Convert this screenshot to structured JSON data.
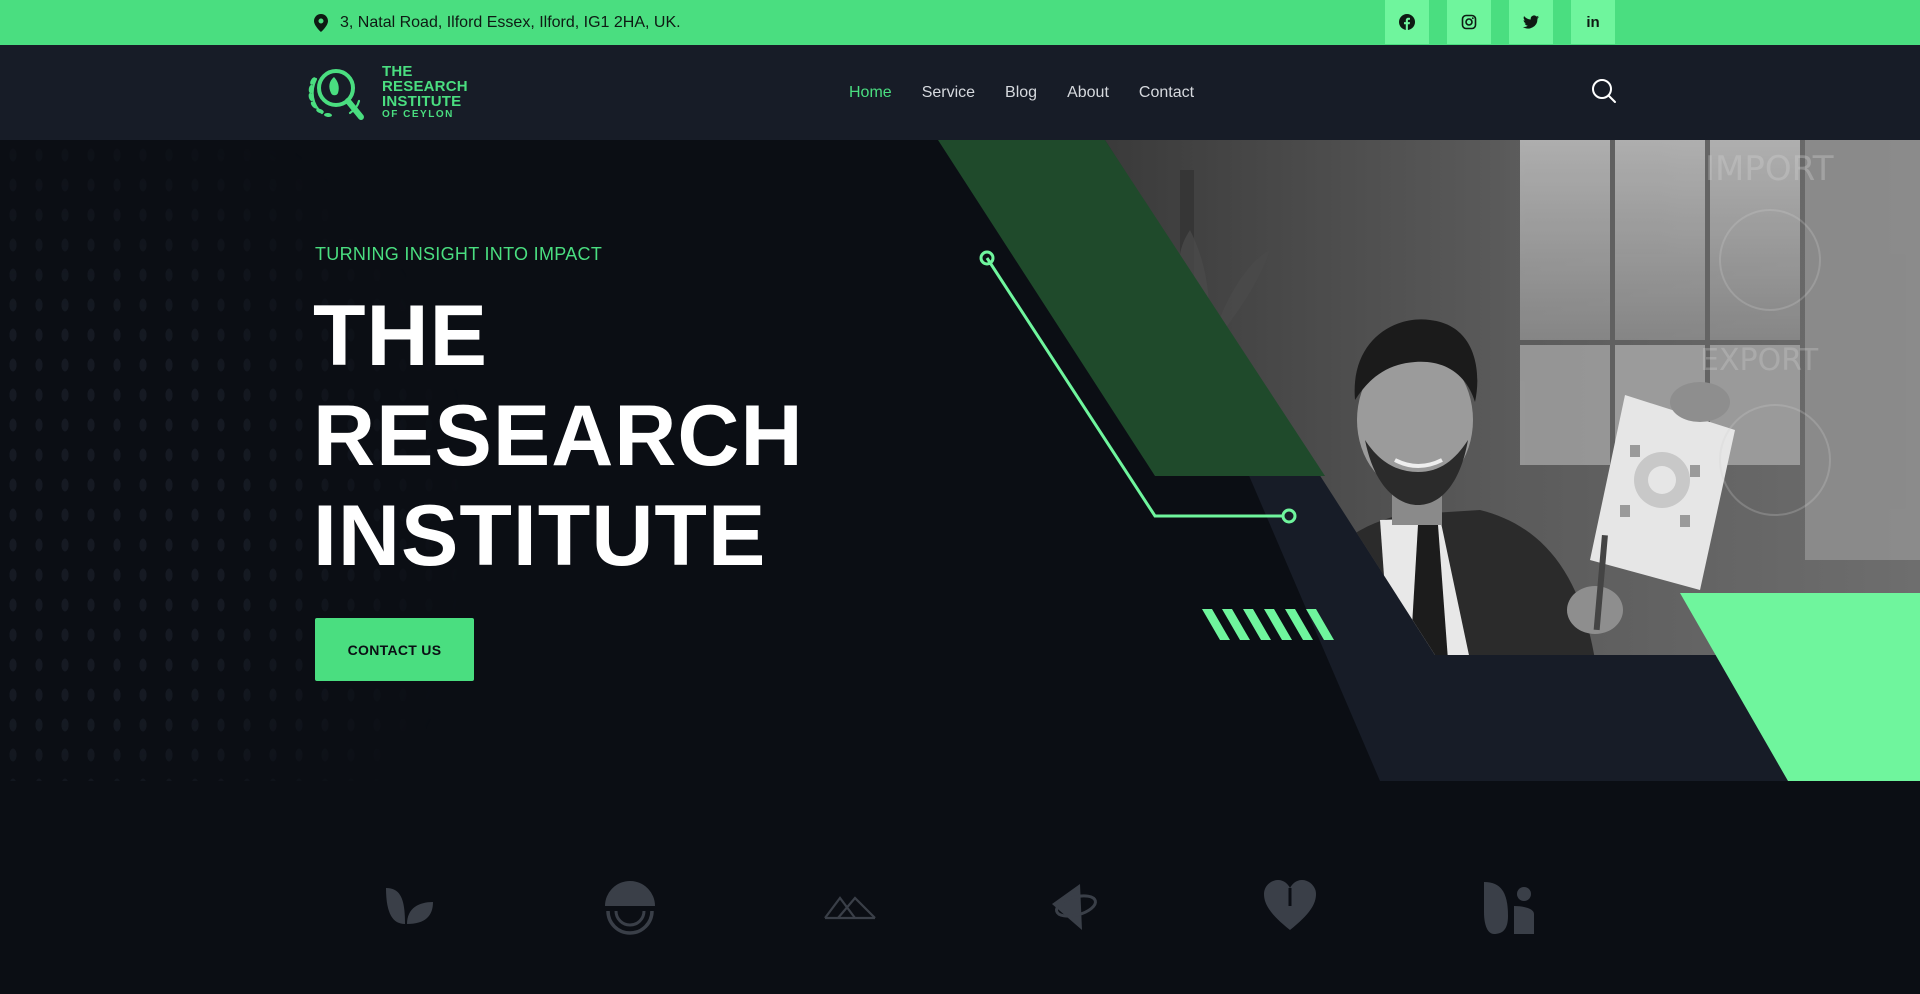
{
  "topbar": {
    "address": "3, Natal Road, Ilford Essex, Ilford, IG1 2HA, UK.",
    "social": [
      {
        "name": "facebook",
        "icon": "facebook-icon"
      },
      {
        "name": "instagram",
        "icon": "instagram-icon"
      },
      {
        "name": "twitter",
        "icon": "twitter-icon"
      },
      {
        "name": "linkedin",
        "icon": "linkedin-icon",
        "label": "in"
      }
    ]
  },
  "brand": {
    "line1": "THE",
    "line2": "RESEARCH",
    "line3": "INSTITUTE",
    "line4": "OF CEYLON",
    "logo_icon": "magnifier-laurel-logo"
  },
  "nav": {
    "items": [
      "Home",
      "Service",
      "Blog",
      "About",
      "Contact"
    ],
    "active": "Home",
    "search_icon": "search-icon"
  },
  "hero": {
    "eyebrow": "TURNING INSIGHT INTO IMPACT",
    "title_line1": "THE",
    "title_line2": "RESEARCH",
    "title_line3": "INSTITUTE",
    "cta_label": "CONTACT US"
  },
  "partners": {
    "logos": [
      "leaf-logo-icon",
      "half-circle-logo-icon",
      "mountains-logo-icon",
      "planet-logo-icon",
      "heart-logo-icon",
      "sprout-logo-icon"
    ]
  },
  "colors": {
    "accent": "#4ade80",
    "accent_light": "#6ff59d",
    "dark_bg": "#0b0e14",
    "header_bg": "#171c27",
    "dark_green": "#1f4a2b"
  }
}
